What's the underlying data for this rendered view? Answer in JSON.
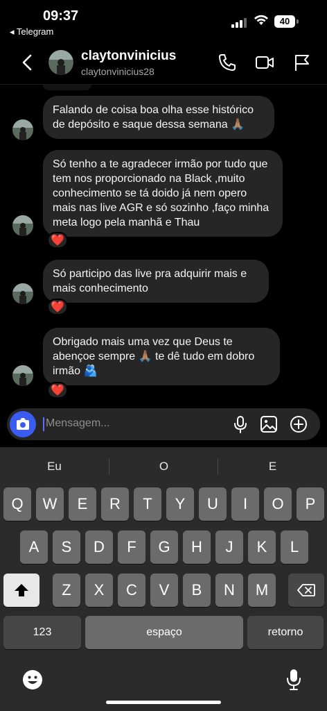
{
  "status": {
    "time": "09:37",
    "back_app": "◂ Telegram",
    "battery": "40"
  },
  "header": {
    "name": "claytonvinicius",
    "username": "claytonvinicius28"
  },
  "messages": [
    {
      "text": "Falando de coisa boa olha esse histórico de depósito e saque dessa semana 🙏🏽",
      "reaction": ""
    },
    {
      "text": "Só tenho a te agradecer irmão por tudo que tem nos proporcionado na Black ,muito conhecimento se tá doido já nem opero mais nas live AGR e só sozinho ,faço minha meta logo pela manhã e Thau",
      "reaction": "❤️"
    },
    {
      "text": "Só participo das live pra adquirir mais e mais conhecimento",
      "reaction": "❤️"
    },
    {
      "text": "Obrigado mais uma vez que Deus te abençoe sempre 🙏🏽 te dê tudo em dobro irmão 🫂",
      "reaction": "❤️"
    }
  ],
  "composer": {
    "placeholder": "Mensagem..."
  },
  "keyboard": {
    "suggestions": [
      "Eu",
      "O",
      "E"
    ],
    "row1": [
      "Q",
      "W",
      "E",
      "R",
      "T",
      "Y",
      "U",
      "I",
      "O",
      "P"
    ],
    "row2": [
      "A",
      "S",
      "D",
      "F",
      "G",
      "H",
      "J",
      "K",
      "L"
    ],
    "row3": [
      "Z",
      "X",
      "C",
      "V",
      "B",
      "N",
      "M"
    ],
    "numbers": "123",
    "space": "espaço",
    "return": "retorno"
  },
  "colors": {
    "accent": "#3a5cf0",
    "bubble": "#262626",
    "keyboard": "#2b2b2b",
    "key": "#6b6b6b"
  }
}
